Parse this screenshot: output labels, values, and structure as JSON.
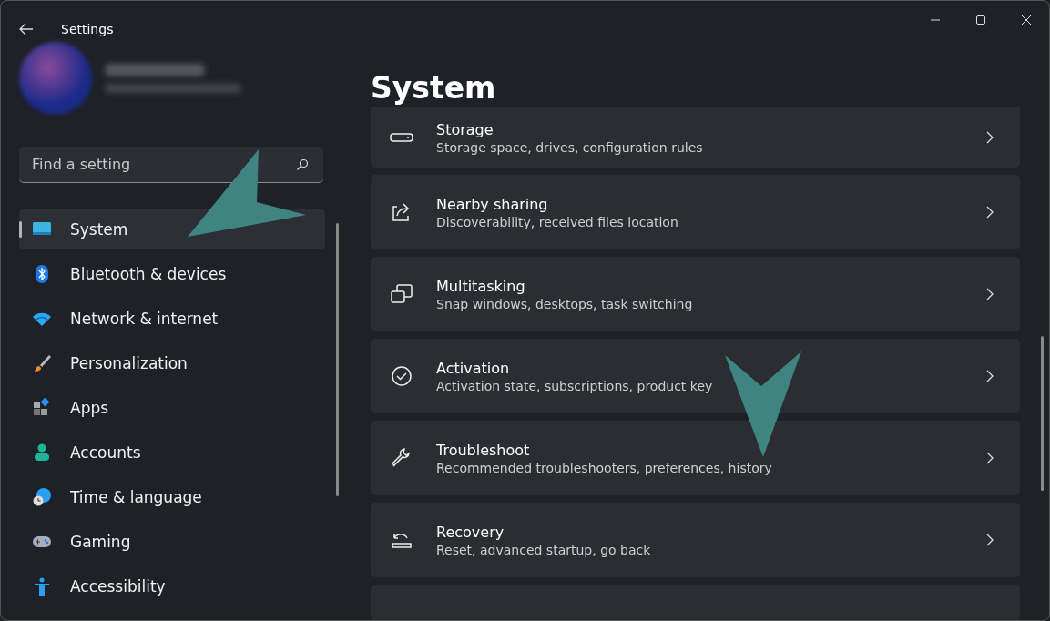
{
  "window": {
    "title": "Settings"
  },
  "search": {
    "placeholder": "Find a setting"
  },
  "sidebar": {
    "items": [
      {
        "label": "System",
        "selected": true
      },
      {
        "label": "Bluetooth & devices",
        "selected": false
      },
      {
        "label": "Network & internet",
        "selected": false
      },
      {
        "label": "Personalization",
        "selected": false
      },
      {
        "label": "Apps",
        "selected": false
      },
      {
        "label": "Accounts",
        "selected": false
      },
      {
        "label": "Time & language",
        "selected": false
      },
      {
        "label": "Gaming",
        "selected": false
      },
      {
        "label": "Accessibility",
        "selected": false
      }
    ]
  },
  "page": {
    "title": "System",
    "cards": [
      {
        "title": "Storage",
        "subtitle": "Storage space, drives, configuration rules"
      },
      {
        "title": "Nearby sharing",
        "subtitle": "Discoverability, received files location"
      },
      {
        "title": "Multitasking",
        "subtitle": "Snap windows, desktops, task switching"
      },
      {
        "title": "Activation",
        "subtitle": "Activation state, subscriptions, product key"
      },
      {
        "title": "Troubleshoot",
        "subtitle": "Recommended troubleshooters, preferences, history"
      },
      {
        "title": "Recovery",
        "subtitle": "Reset, advanced startup, go back"
      }
    ]
  }
}
